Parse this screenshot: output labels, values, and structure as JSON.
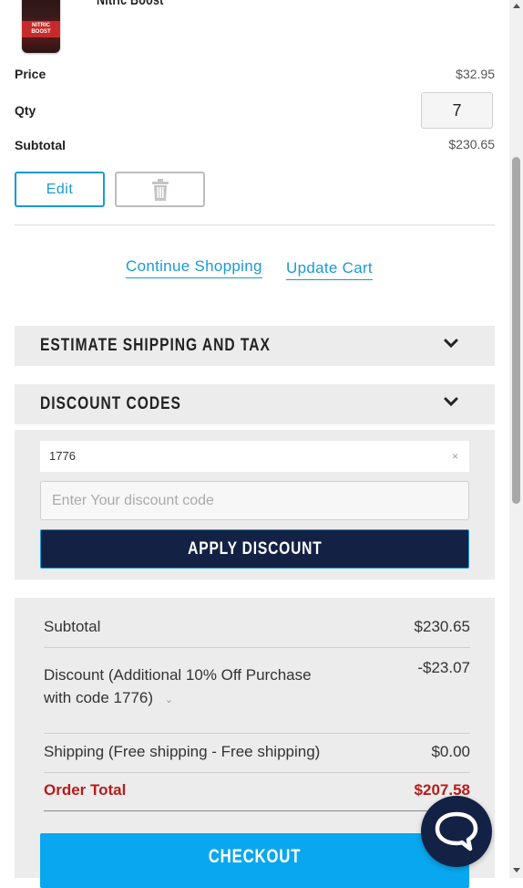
{
  "product": {
    "name": "Nitric Boost",
    "image_label": "NITRIC BOOST"
  },
  "item": {
    "price_label": "Price",
    "price_value": "$32.95",
    "qty_label": "Qty",
    "qty_value": "7",
    "subtotal_label": "Subtotal",
    "subtotal_value": "$230.65",
    "edit_label": "Edit"
  },
  "links": {
    "continue_shopping": "Continue Shopping",
    "update_cart": "Update Cart"
  },
  "panels": {
    "shipping_title": "ESTIMATE SHIPPING AND TAX",
    "discount_title": "DISCOUNT CODES"
  },
  "discount": {
    "applied_code": "1776",
    "remove_glyph": "×",
    "input_placeholder": "Enter Your discount code",
    "input_value": "",
    "apply_label": "APPLY DISCOUNT"
  },
  "totals": {
    "subtotal_label": "Subtotal",
    "subtotal_value": "$230.65",
    "discount_label_line1": "Discount (Additional 10% Off Purchase",
    "discount_label_line2": "with code 1776)",
    "discount_value": "-$23.07",
    "shipping_label": "Shipping (Free shipping - Free shipping)",
    "shipping_value": "$0.00",
    "order_total_label": "Order Total",
    "order_total_value": "$207.58",
    "checkout_label": "CHECKOUT"
  },
  "colors": {
    "accent": "#1a9ad6",
    "navy": "#132244",
    "checkout": "#09a7ef",
    "order_total": "#b71c1c"
  },
  "icons": {
    "delete": "trash-icon",
    "chevron": "chevron-down-icon",
    "chat": "chat-bubble-icon"
  }
}
